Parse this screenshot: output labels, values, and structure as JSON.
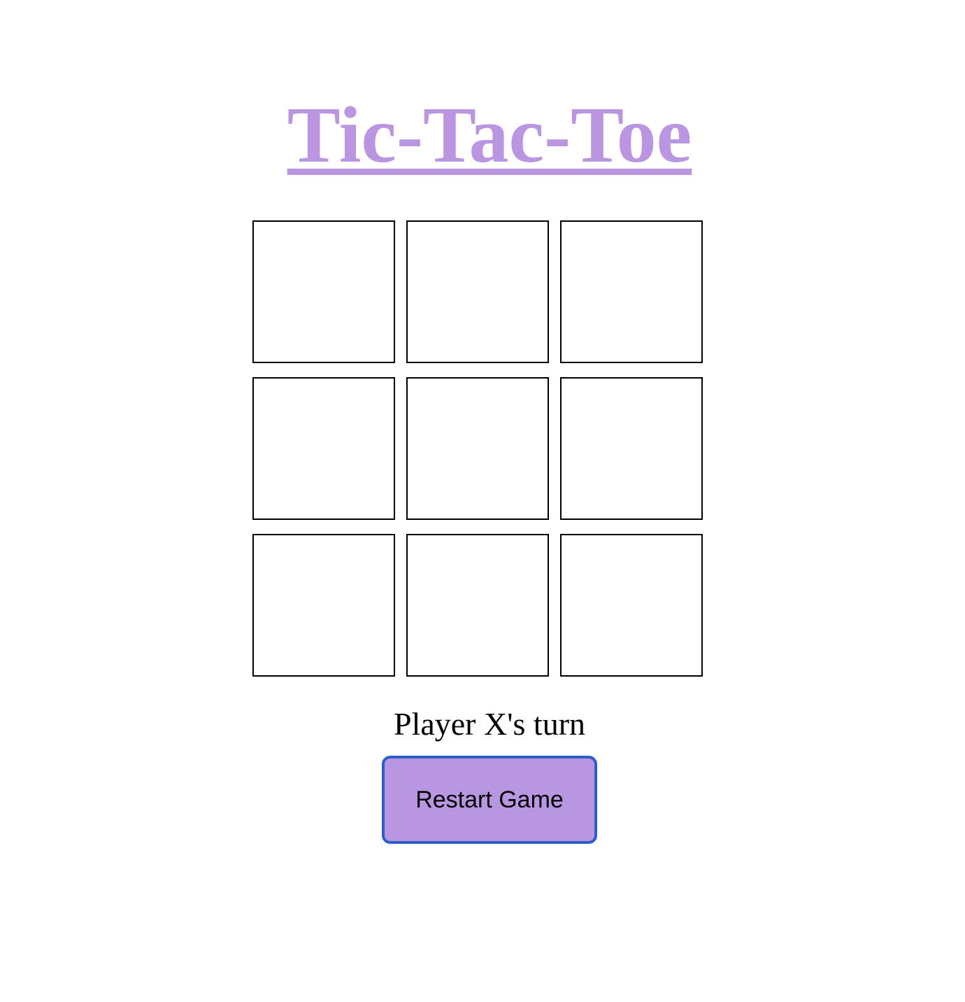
{
  "title": "Tic-Tac-Toe",
  "board": {
    "cells": [
      "",
      "",
      "",
      "",
      "",
      "",
      "",
      "",
      ""
    ]
  },
  "status": "Player X's turn",
  "restart_label": "Restart Game",
  "colors": {
    "accent": "#ba96e0",
    "button_border": "#2b5ec6",
    "cell_border": "#000000",
    "background": "#ffffff"
  }
}
